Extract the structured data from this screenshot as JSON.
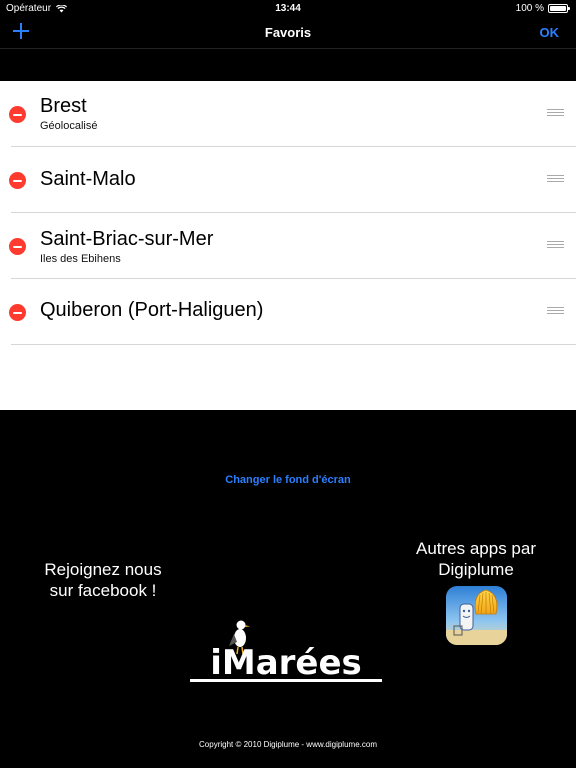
{
  "status_bar": {
    "carrier": "Opérateur",
    "time": "13:44",
    "battery": "100 %"
  },
  "nav": {
    "title": "Favoris",
    "ok_label": "OK",
    "add_icon": "plus-icon"
  },
  "favorites": [
    {
      "name": "Brest",
      "subtitle": "Géolocalisé"
    },
    {
      "name": "Saint-Malo",
      "subtitle": ""
    },
    {
      "name": "Saint-Briac-sur-Mer",
      "subtitle": "Iles des Ebihens"
    },
    {
      "name": "Quiberon (Port-Haliguen)",
      "subtitle": ""
    }
  ],
  "footer": {
    "wallpaper_link": "Changer le fond d'écran",
    "facebook_line1": "Rejoignez nous",
    "facebook_line2": "sur facebook !",
    "other_apps_line1": "Autres apps par",
    "other_apps_line2": "Digiplume",
    "logo_text": "iMarées",
    "copyright": "Copyright © 2010 Digiplume - www.digiplume.com"
  },
  "colors": {
    "accent": "#2a7fff",
    "delete": "#ff3b30",
    "background": "#000000",
    "list_background": "#ffffff"
  }
}
